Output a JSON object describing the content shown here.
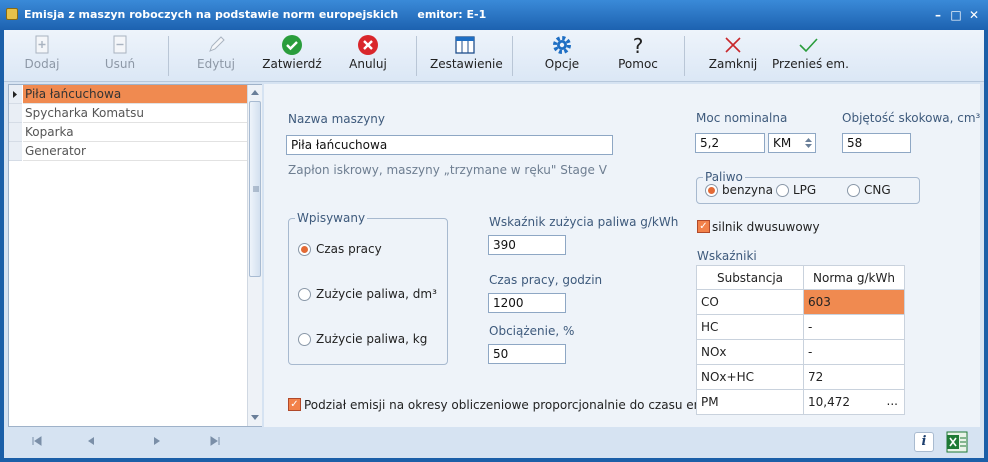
{
  "window": {
    "title": "Emisja z maszyn roboczych na podstawie norm europejskich     emitor: E-1"
  },
  "toolbar": {
    "add": "Dodaj",
    "remove": "Usuń",
    "edit": "Edytuj",
    "confirm": "Zatwierdź",
    "cancel": "Anuluj",
    "summary": "Zestawienie",
    "options": "Opcje",
    "help": "Pomoc",
    "close": "Zamknij",
    "transfer": "Przenieś em."
  },
  "list": {
    "items": [
      "Piła łańcuchowa",
      "Spycharka Komatsu",
      "Koparka",
      "Generator"
    ],
    "selected_index": 0
  },
  "form": {
    "machine_name_label": "Nazwa maszyny",
    "machine_name": "Piła łańcuchowa",
    "description": "Zapłon iskrowy, maszyny  „trzymane w ręku\" Stage  V",
    "input_group_label": "Wpisywany",
    "input_options": [
      "Czas pracy",
      "Zużycie paliwa, dm³",
      "Zużycie paliwa, kg"
    ],
    "input_selected": 0,
    "fuel_rate_label": "Wskaźnik zużycia paliwa g/kWh",
    "fuel_rate": "390",
    "work_time_label": "Czas pracy, godzin",
    "work_time": "1200",
    "load_label": "Obciążenie, %",
    "load": "50",
    "split_label": "Podział emisji na okresy obliczeniowe proporcjonalnie do czasu emisji",
    "split_checked": true,
    "power_label": "Moc nominalna",
    "power": "5,2",
    "power_unit": "KM",
    "displacement_label": "Objętość skokowa, cm³",
    "displacement": "58",
    "fuel_group_label": "Paliwo",
    "fuel_options": [
      "benzyna",
      "LPG",
      "CNG"
    ],
    "fuel_selected": 0,
    "two_stroke_label": "silnik dwusuwowy",
    "two_stroke_checked": true,
    "indicators_label": "Wskaźniki",
    "indicators": {
      "headers": [
        "Substancja",
        "Norma g/kWh"
      ],
      "rows": [
        {
          "substance": "CO",
          "norm": "603"
        },
        {
          "substance": "HC",
          "norm": "-"
        },
        {
          "substance": "NOx",
          "norm": "-"
        },
        {
          "substance": "NOx+HC",
          "norm": "72"
        },
        {
          "substance": "PM",
          "norm": "10,472"
        }
      ],
      "ellipsis": "..."
    }
  },
  "footer": {
    "info": "i"
  },
  "colors": {
    "accent": "#f08a50",
    "titlebar": "#1d62b0",
    "confirm": "#2a9d3c",
    "cancel": "#d9262b",
    "options": "#1f6fc4"
  }
}
